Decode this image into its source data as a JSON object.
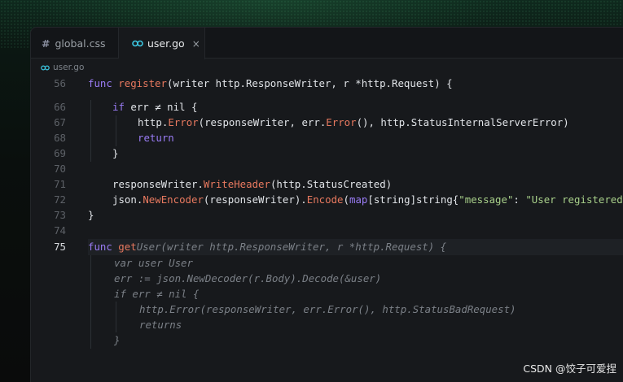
{
  "tabs": [
    {
      "label": "global.css",
      "icon": "hash-icon",
      "active": false
    },
    {
      "label": "user.go",
      "icon": "go-file-icon",
      "active": true
    }
  ],
  "close_glyph": "×",
  "breadcrumb": {
    "label": "user.go",
    "icon": "go-file-icon"
  },
  "gutter": [
    "56",
    "66",
    "67",
    "68",
    "69",
    "70",
    "71",
    "72",
    "73",
    "74",
    "75"
  ],
  "code": {
    "l56": [
      "func",
      " register",
      "(writer http.ResponseWriter, r *http.Request) {"
    ],
    "l66": [
      "if",
      " err ≠ nil {"
    ],
    "l67": [
      "http.",
      "Error",
      "(responseWriter, err.",
      "Error",
      "(), http.StatusInternalServerError)"
    ],
    "l68": [
      "return"
    ],
    "l69": [
      "}"
    ],
    "l71": [
      "responseWriter.",
      "WriteHeader",
      "(http.StatusCreated)"
    ],
    "l72": [
      "json.",
      "NewEncoder",
      "(responseWriter).",
      "Encode",
      "(",
      "map",
      "[string]string{",
      "\"message\"",
      ": ",
      "\"User registered"
    ],
    "l73": [
      "}"
    ],
    "l75": [
      "func",
      " get",
      "User(writer http.ResponseWriter, r *http.Request) {"
    ],
    "ghost": [
      "var user User",
      "err := json.NewDecoder(r.Body).Decode(&user)",
      "if err ≠ nil {",
      "http.Error(responseWriter, err.Error(), http.StatusBadRequest)",
      "returns",
      "}"
    ]
  },
  "watermark": "CSDN @饺子可爱捏",
  "colors": {
    "keyword": "#9a7cf5",
    "function": "#e8795f",
    "string": "#a8d08a",
    "ghost_text": "#7b8087",
    "editor_bg": "#17191c",
    "go_icon": "#3cc6e0"
  }
}
